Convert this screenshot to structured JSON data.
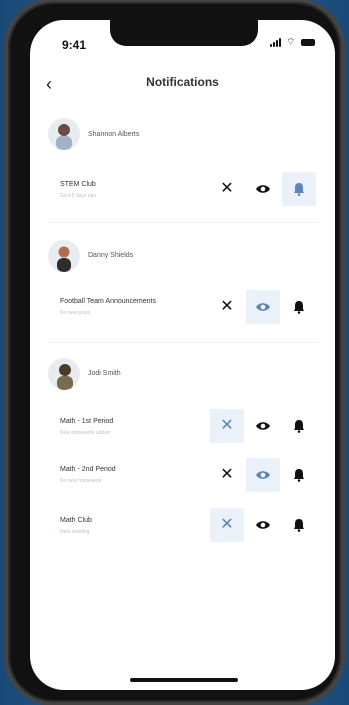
{
  "status": {
    "time": "9:41"
  },
  "header": {
    "title": "Notifications",
    "back_icon": "chevron-left-icon"
  },
  "people": [
    {
      "name": "Shannon Alberts",
      "items": [
        {
          "title": "STEM Club",
          "subtitle": "Sent 5 days ago",
          "selected": "bell"
        }
      ]
    },
    {
      "name": "Danny Shields",
      "items": [
        {
          "title": "Football Team Announcements",
          "subtitle": "No new posts",
          "selected": "eye"
        }
      ]
    },
    {
      "name": "Jodi Smith",
      "items": [
        {
          "title": "Math - 1st Period",
          "subtitle": "New homework added",
          "selected": "x"
        },
        {
          "title": "Math - 2nd Period",
          "subtitle": "No new homework",
          "selected": "eye"
        },
        {
          "title": "Math Club",
          "subtitle": "Next meeting",
          "selected": "x"
        }
      ]
    }
  ],
  "colors": {
    "accent": "#5b86b5",
    "selected_bg": "#eaf1f8"
  }
}
